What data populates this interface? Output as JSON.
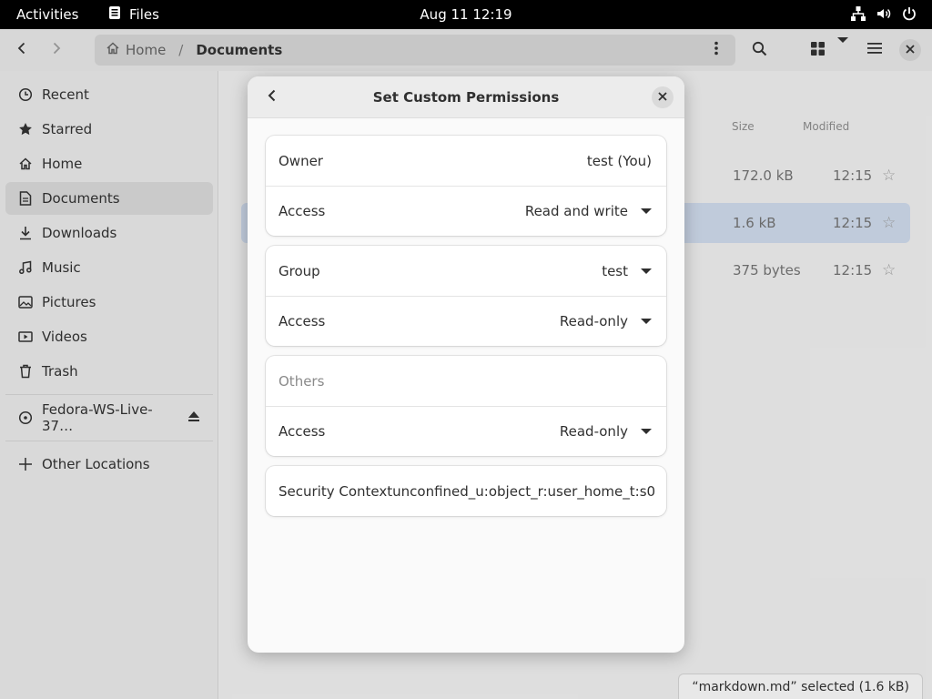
{
  "topbar": {
    "activities": "Activities",
    "app_name": "Files",
    "clock": "Aug 11  12:19"
  },
  "pathbar": {
    "home": "Home",
    "separator": "/",
    "current": "Documents"
  },
  "sidebar": {
    "items": [
      {
        "label": "Recent",
        "icon": "clock-icon"
      },
      {
        "label": "Starred",
        "icon": "star-icon"
      },
      {
        "label": "Home",
        "icon": "home-icon"
      },
      {
        "label": "Documents",
        "icon": "document-icon",
        "active": true
      },
      {
        "label": "Downloads",
        "icon": "download-icon"
      },
      {
        "label": "Music",
        "icon": "music-icon"
      },
      {
        "label": "Pictures",
        "icon": "picture-icon"
      },
      {
        "label": "Videos",
        "icon": "video-icon"
      },
      {
        "label": "Trash",
        "icon": "trash-icon"
      }
    ],
    "drive": {
      "label": "Fedora-WS-Live-37…",
      "icon": "disc-icon"
    },
    "other": {
      "label": "Other Locations",
      "icon": "plus-icon"
    }
  },
  "file_list": {
    "columns": {
      "size": "Size",
      "modified": "Modified"
    },
    "rows": [
      {
        "size": "172.0 kB",
        "modified": "12:15",
        "selected": false
      },
      {
        "size": "1.6 kB",
        "modified": "12:15",
        "selected": true
      },
      {
        "size": "375 bytes",
        "modified": "12:15",
        "selected": false
      }
    ]
  },
  "statusbar": {
    "text": "“markdown.md” selected  (1.6 kB)"
  },
  "dialog": {
    "title": "Set Custom Permissions",
    "owner": {
      "label": "Owner",
      "value": "test (You)",
      "access_label": "Access",
      "access_value": "Read and write"
    },
    "group": {
      "label": "Group",
      "value": "test",
      "access_label": "Access",
      "access_value": "Read-only"
    },
    "others": {
      "label": "Others",
      "access_label": "Access",
      "access_value": "Read-only"
    },
    "security": {
      "label": "Security Context",
      "value": "unconfined_u:object_r:user_home_t:s0"
    }
  },
  "colors": {
    "selection": "#c8d4e4",
    "topbar": "#000000"
  }
}
